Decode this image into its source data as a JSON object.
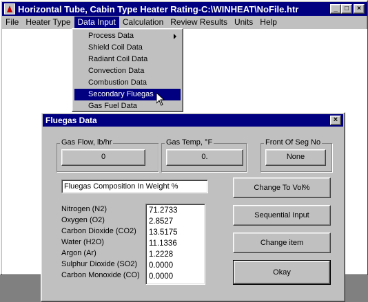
{
  "main_window": {
    "title": "Horizontal Tube, Cabin Type Heater Rating-C:\\WINHEAT\\NoFile.htr",
    "caption_buttons": [
      "_",
      "□",
      "×"
    ],
    "menu": [
      "File",
      "Heater Type",
      "Data Input",
      "Calculation",
      "Review Results",
      "Units",
      "Help"
    ]
  },
  "data_input_menu": {
    "items": [
      "Process Data",
      "Shield Coil Data",
      "Radiant Coil Data",
      "Convection Data",
      "Combustion Data",
      "Secondary Fluegas",
      "Gas Fuel Data"
    ],
    "selected": "Secondary Fluegas"
  },
  "dialog": {
    "title": "Fluegas Data",
    "close": "×",
    "gas_flow": {
      "label": "Gas Flow, lb/hr",
      "value": "0"
    },
    "gas_temp": {
      "label": "Gas Temp, °F",
      "value": "0."
    },
    "front_seg": {
      "label": "Front Of Seg No",
      "value": "None"
    },
    "composition_title": "Fluegas Composition In Weight %",
    "components": [
      {
        "name": "Nitrogen (N2)",
        "value": "71.2733"
      },
      {
        "name": "Oxygen (O2)",
        "value": "2.8527"
      },
      {
        "name": "Carbon Dioxide (CO2)",
        "value": "13.5175"
      },
      {
        "name": "Water (H2O)",
        "value": "11.1336"
      },
      {
        "name": "Argon (Ar)",
        "value": "1.2228"
      },
      {
        "name": "Sulphur Dioxide (SO2)",
        "value": "0.0000"
      },
      {
        "name": "Carbon Monoxide (CO)",
        "value": "0.0000"
      }
    ],
    "buttons": {
      "change_to_vol": "Change To Vol%",
      "sequential_input": "Sequential Input",
      "change_item": "Change item",
      "okay": "Okay"
    }
  }
}
